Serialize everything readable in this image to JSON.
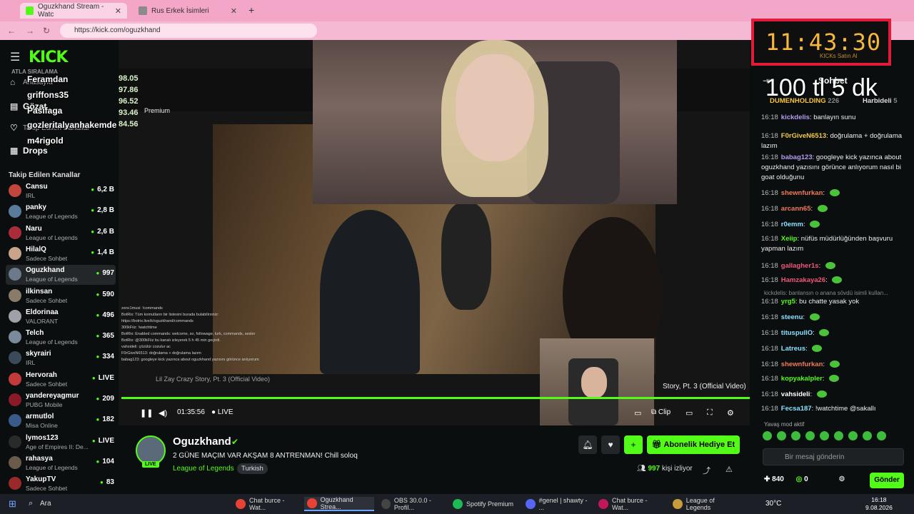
{
  "browser": {
    "tabs": [
      {
        "title": "Oguzkhand Stream - Watc",
        "active": true
      },
      {
        "title": "Rus Erkek İsimleri",
        "active": false
      }
    ],
    "url": "https://kick.com/oguzkhand",
    "new_tab": "+"
  },
  "sidebar": {
    "logo": "KICK",
    "menu": [
      {
        "icon": "home-icon",
        "label": "Anasayfa"
      },
      {
        "icon": "browse-icon",
        "label": "Gözat"
      },
      {
        "icon": "heart-icon",
        "label": "Takip Edilen Kanallar"
      },
      {
        "icon": "drops-icon",
        "label": "Drops"
      }
    ],
    "overlay_leaderboard": [
      {
        "name": "Feramdan",
        "score": "98.05"
      },
      {
        "name": "griffons35",
        "score": "97.86"
      },
      {
        "name": "Pasifaga",
        "score": "96.52"
      },
      {
        "name": "gozleritalyanhakemde",
        "score": "93.46"
      },
      {
        "name": "m4rigold",
        "score": "84.56"
      }
    ],
    "overlay_label": "ATLA SIRALAMA",
    "followed_title": "Takip Edilen Kanallar",
    "channels": [
      {
        "name": "Cansu",
        "category": "IRL",
        "viewers": "6,2 B",
        "color": "#c2463c"
      },
      {
        "name": "panky",
        "category": "League of Legends",
        "viewers": "2,8 B",
        "color": "#5a7a9a"
      },
      {
        "name": "Naru",
        "category": "League of Legends",
        "viewers": "2,6 B",
        "color": "#a82c3a"
      },
      {
        "name": "HilalQ",
        "category": "Sadece Sohbet",
        "viewers": "1,4 B",
        "color": "#c8a48a"
      },
      {
        "name": "Oguzkhand",
        "category": "League of Legends",
        "viewers": "997",
        "color": "#6a7a8a",
        "selected": true
      },
      {
        "name": "ilkinsan",
        "category": "Sadece Sohbet",
        "viewers": "590",
        "color": "#8a7a6a"
      },
      {
        "name": "Eldorinaa",
        "category": "VALORANT",
        "viewers": "496",
        "color": "#a0a0a8"
      },
      {
        "name": "Telch",
        "category": "League of Legends",
        "viewers": "365",
        "color": "#7a8a9a"
      },
      {
        "name": "skyrairi",
        "category": "IRL",
        "viewers": "334",
        "color": "#3a4a5a"
      },
      {
        "name": "Hervorah",
        "category": "Sadece Sohbet",
        "viewers": "LIVE",
        "color": "#c23a3a"
      },
      {
        "name": "yandereyagmur",
        "category": "PUBG Mobile",
        "viewers": "209",
        "color": "#8a1a2a"
      },
      {
        "name": "armutlol",
        "category": "Misa Online",
        "viewers": "182",
        "color": "#3a5a8a"
      },
      {
        "name": "lymos123",
        "category": "Age of Empires II: De...",
        "viewers": "LIVE",
        "color": "#2a2a2a"
      },
      {
        "name": "rahasya",
        "category": "League of Legends",
        "viewers": "104",
        "color": "#6a5a4a"
      },
      {
        "name": "YakupTV",
        "category": "Sadece Sohbet",
        "viewers": "83",
        "color": "#9a2a2a"
      }
    ]
  },
  "video": {
    "yt_premium": "Premium",
    "yt_title_overlay": "Lil Zay Crazy Story, Pt. 3 (Official Video)",
    "yt_title_right": "Story, Pt. 3 (Official Video)",
    "time": "01:35:56",
    "live_label": "LIVE",
    "clip_label": "Clip",
    "overlay_chat": [
      "zenc1musi: !commands",
      "BotRix: Tüm komutların bir listesini burada bulabilirsiniz:",
      "https://botrix.live/k/oguzkhand/commands",
      "300kFiiz: !watchtime",
      "BotRix: Enabled commands: welcome, so, followage, lurk, commands, sesler",
      "BotRix: @300kFiiz bu kanalı izleyerek 5 h 45 min geçirdi.",
      "vahsideli: çözülür cozulur ac",
      "F0rGiveN6513: doğrulama + doğrulama lazım",
      "babag123: googleye kick yazınca about oguzkhand yazısını görünce anlıyorum"
    ]
  },
  "timer": {
    "time": "11:43:30",
    "sub": "KICKs Satın Al"
  },
  "promo_text": "100 tl 5 dk",
  "stream": {
    "streamer": "Oguzkhand",
    "live_tag": "LIVE",
    "title": "2 GÜNE MAÇIM VAR AKŞAM 8 ANTRENMAN! Chill soloq",
    "category": "League of Legends",
    "tag": "Turkish",
    "gift_label": "Abonelik Hediye Et",
    "viewers": "997",
    "viewers_label": "kişi izliyor"
  },
  "chat": {
    "title": "Sohbet",
    "pinned": [
      {
        "name": "DUMENHOLDING",
        "count": "226"
      },
      {
        "name": "Harbideli",
        "count": "5"
      }
    ],
    "messages": [
      {
        "ts": "16:18",
        "user": "kickdelis",
        "color": "#b69cf0",
        "text": "banlayın sunu"
      },
      {
        "ts": "16:18",
        "user": "F0rGiveN6513",
        "color": "#f2c94c",
        "text": "doğrulama + doğrulama lazım"
      },
      {
        "ts": "16:18",
        "user": "babag123",
        "color": "#b69cf0",
        "text": "googleye kick yazınca about oguzkhand yazısını görünce anlıyorum nasıl bi goat olduğunu"
      },
      {
        "ts": "16:18",
        "user": "shewnfurkan",
        "color": "#f07a5a",
        "text": ""
      },
      {
        "ts": "16:18",
        "user": "arcann65",
        "color": "#f07a5a",
        "text": ""
      },
      {
        "ts": "16:18",
        "user": "r0emm",
        "color": "#8ae0ff",
        "text": ""
      },
      {
        "ts": "16:18",
        "user": "Xeiip",
        "color": "#53fc18",
        "text": "nüfüs müdürlüğünden başvuru yapman lazım"
      },
      {
        "ts": "16:18",
        "user": "gallagher1s",
        "color": "#f0567a",
        "text": ""
      },
      {
        "ts": "16:18",
        "user": "Hamzakaya26",
        "color": "#f0567a",
        "text": ""
      },
      {
        "ts": "16:18",
        "user": "yrg5",
        "color": "#53fc18",
        "text": "bu chatte yasak yok"
      },
      {
        "ts": "16:18",
        "user": "steenu",
        "color": "#8ae0ff",
        "text": ""
      },
      {
        "ts": "16:18",
        "user": "tituspullO",
        "color": "#8ae0ff",
        "text": ""
      },
      {
        "ts": "16:18",
        "user": "Latreus",
        "color": "#8ae0ff",
        "text": ""
      },
      {
        "ts": "16:18",
        "user": "shewnfurkan",
        "color": "#f07a5a",
        "text": ""
      },
      {
        "ts": "16:18",
        "user": "kopyakalpler",
        "color": "#53fc18",
        "text": ""
      },
      {
        "ts": "16:18",
        "user": "vahsideli",
        "color": "#ffffff",
        "text": ""
      },
      {
        "ts": "16:18",
        "user": "Fecsa187",
        "color": "#8ae0ff",
        "text": "!watchtime @sakallı"
      }
    ],
    "reply_preview": "kickdelis: banlansın o anana sövdü isimli kullan...",
    "slow_mode": "Yavaş mod aktif",
    "input_placeholder": "Bir mesaj gönderin",
    "points": "840",
    "kicks": "0",
    "send_label": "Gönder"
  },
  "taskbar": {
    "search": "Ara",
    "apps": [
      {
        "label": "Chat burce - Wat...",
        "color": "#e94235"
      },
      {
        "label": "Oguzkhand Strea...",
        "color": "#e94235",
        "active": true
      },
      {
        "label": "OBS 30.0.0 - Profil...",
        "color": "#444"
      },
      {
        "label": "Spotify Premium",
        "color": "#1db954"
      },
      {
        "label": "#genel | shawty - ...",
        "color": "#5865f2"
      },
      {
        "label": "Chat burce - Wat...",
        "color": "#c2185b"
      },
      {
        "label": "League of Legends",
        "color": "#c89b3c"
      }
    ],
    "temperature": "30°C",
    "time": "16:18",
    "date": "9.08.2026"
  }
}
